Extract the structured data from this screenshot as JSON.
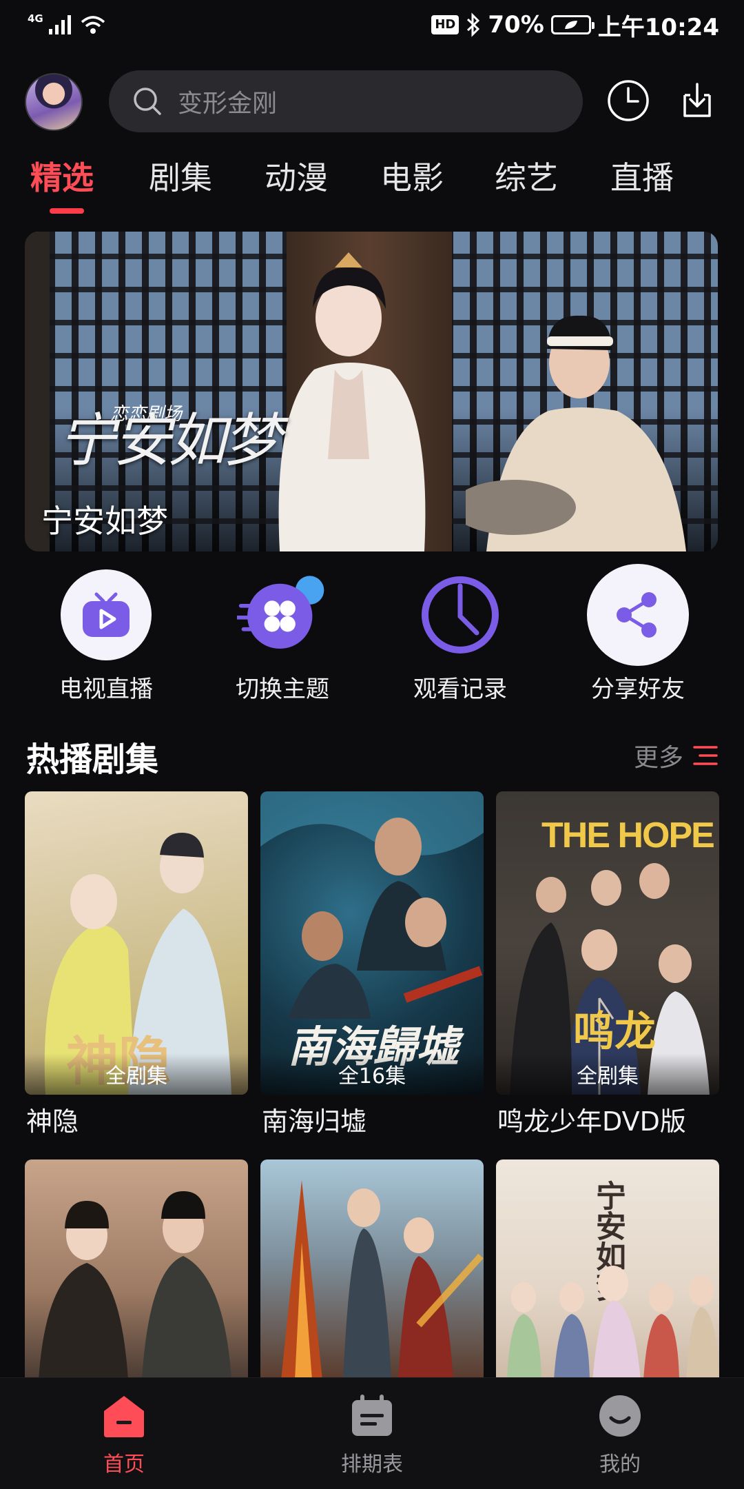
{
  "status_bar": {
    "network": "4G",
    "hd": "HD",
    "battery": "70%",
    "time": "上午10:24"
  },
  "search": {
    "placeholder": "变形金刚"
  },
  "tabs": [
    {
      "label": "精选",
      "active": true
    },
    {
      "label": "剧集"
    },
    {
      "label": "动漫"
    },
    {
      "label": "电影"
    },
    {
      "label": "综艺"
    },
    {
      "label": "直播"
    }
  ],
  "banner": {
    "title": "宁安如梦",
    "logo_text": "宁安如梦",
    "studio_text": "恋恋剧场"
  },
  "quick_actions": [
    {
      "label": "电视直播",
      "icon": "tv-icon"
    },
    {
      "label": "切换主题",
      "icon": "theme-icon"
    },
    {
      "label": "观看记录",
      "icon": "history-icon"
    },
    {
      "label": "分享好友",
      "icon": "share-icon"
    }
  ],
  "section": {
    "title": "热播剧集",
    "more": "更多"
  },
  "posters": [
    {
      "name": "神隐",
      "badge": "全剧集",
      "art": "神隐"
    },
    {
      "name": "南海归墟",
      "badge": "全16集",
      "art": "南海歸墟"
    },
    {
      "name": "鸣龙少年DVD版",
      "badge": "全剧集",
      "art": "THE HOPE"
    },
    {
      "name": "",
      "badge": ""
    },
    {
      "name": "",
      "badge": ""
    },
    {
      "name": "",
      "badge": "",
      "art": "宁安如梦"
    }
  ],
  "bottom_nav": [
    {
      "label": "首页",
      "active": true
    },
    {
      "label": "排期表"
    },
    {
      "label": "我的"
    }
  ],
  "colors": {
    "accent": "#ff4d57",
    "background": "#0c0c0e",
    "icon_purple": "#7b5ce6"
  }
}
